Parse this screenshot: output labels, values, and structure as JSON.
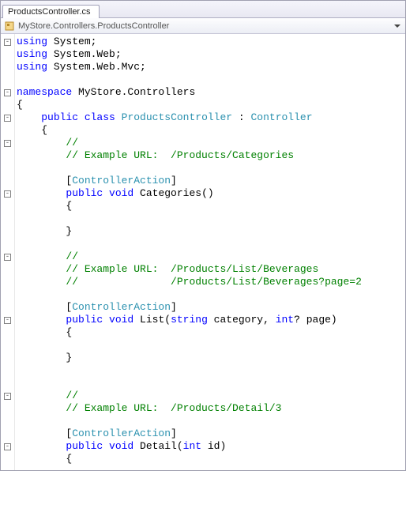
{
  "tab": {
    "title": "ProductsController.cs"
  },
  "nav": {
    "path": "MyStore.Controllers.ProductsController"
  },
  "code": {
    "lines": [
      {
        "fold": "-",
        "seg": [
          [
            "kw",
            "using"
          ],
          [
            "pl",
            " System;"
          ]
        ]
      },
      {
        "fold": "",
        "seg": [
          [
            "kw",
            "using"
          ],
          [
            "pl",
            " System.Web;"
          ]
        ]
      },
      {
        "fold": "",
        "seg": [
          [
            "kw",
            "using"
          ],
          [
            "pl",
            " System.Web.Mvc;"
          ]
        ]
      },
      {
        "fold": "",
        "seg": []
      },
      {
        "fold": "-",
        "seg": [
          [
            "kw",
            "namespace"
          ],
          [
            "pl",
            " MyStore.Controllers"
          ]
        ]
      },
      {
        "fold": "",
        "seg": [
          [
            "pl",
            "{"
          ]
        ]
      },
      {
        "fold": "-",
        "seg": [
          [
            "pl",
            "    "
          ],
          [
            "kw",
            "public class"
          ],
          [
            "pl",
            " "
          ],
          [
            "type",
            "ProductsController"
          ],
          [
            "pl",
            " : "
          ],
          [
            "type",
            "Controller"
          ]
        ]
      },
      {
        "fold": "",
        "seg": [
          [
            "pl",
            "    {"
          ]
        ]
      },
      {
        "fold": "-",
        "seg": [
          [
            "pl",
            "        "
          ],
          [
            "cm",
            "//"
          ]
        ]
      },
      {
        "fold": "",
        "seg": [
          [
            "pl",
            "        "
          ],
          [
            "cm",
            "// Example URL:  /Products/Categories"
          ]
        ]
      },
      {
        "fold": "",
        "seg": []
      },
      {
        "fold": "",
        "seg": [
          [
            "pl",
            "        ["
          ],
          [
            "type",
            "ControllerAction"
          ],
          [
            "pl",
            "]"
          ]
        ]
      },
      {
        "fold": "-",
        "seg": [
          [
            "pl",
            "        "
          ],
          [
            "kw",
            "public void"
          ],
          [
            "pl",
            " Categories()"
          ]
        ]
      },
      {
        "fold": "",
        "seg": [
          [
            "pl",
            "        {"
          ]
        ]
      },
      {
        "fold": "",
        "seg": []
      },
      {
        "fold": "",
        "seg": [
          [
            "pl",
            "        }"
          ]
        ]
      },
      {
        "fold": "",
        "seg": []
      },
      {
        "fold": "-",
        "seg": [
          [
            "pl",
            "        "
          ],
          [
            "cm",
            "//"
          ]
        ]
      },
      {
        "fold": "",
        "seg": [
          [
            "pl",
            "        "
          ],
          [
            "cm",
            "// Example URL:  /Products/List/Beverages"
          ]
        ]
      },
      {
        "fold": "",
        "seg": [
          [
            "pl",
            "        "
          ],
          [
            "cm",
            "//               /Products/List/Beverages?page=2"
          ]
        ]
      },
      {
        "fold": "",
        "seg": []
      },
      {
        "fold": "",
        "seg": [
          [
            "pl",
            "        ["
          ],
          [
            "type",
            "ControllerAction"
          ],
          [
            "pl",
            "]"
          ]
        ]
      },
      {
        "fold": "-",
        "seg": [
          [
            "pl",
            "        "
          ],
          [
            "kw",
            "public void"
          ],
          [
            "pl",
            " List("
          ],
          [
            "kw",
            "string"
          ],
          [
            "pl",
            " category, "
          ],
          [
            "kw",
            "int"
          ],
          [
            "pl",
            "? page)"
          ]
        ]
      },
      {
        "fold": "",
        "seg": [
          [
            "pl",
            "        {"
          ]
        ]
      },
      {
        "fold": "",
        "seg": []
      },
      {
        "fold": "",
        "seg": [
          [
            "pl",
            "        }"
          ]
        ]
      },
      {
        "fold": "",
        "seg": []
      },
      {
        "fold": "",
        "seg": []
      },
      {
        "fold": "-",
        "seg": [
          [
            "pl",
            "        "
          ],
          [
            "cm",
            "//"
          ]
        ]
      },
      {
        "fold": "",
        "seg": [
          [
            "pl",
            "        "
          ],
          [
            "cm",
            "// Example URL:  /Products/Detail/3"
          ]
        ]
      },
      {
        "fold": "",
        "seg": []
      },
      {
        "fold": "",
        "seg": [
          [
            "pl",
            "        ["
          ],
          [
            "type",
            "ControllerAction"
          ],
          [
            "pl",
            "]"
          ]
        ]
      },
      {
        "fold": "-",
        "seg": [
          [
            "pl",
            "        "
          ],
          [
            "kw",
            "public void"
          ],
          [
            "pl",
            " Detail("
          ],
          [
            "kw",
            "int"
          ],
          [
            "pl",
            " id)"
          ]
        ]
      },
      {
        "fold": "",
        "seg": [
          [
            "pl",
            "        {"
          ]
        ]
      },
      {
        "fold": "",
        "seg": []
      },
      {
        "fold": "",
        "seg": [
          [
            "pl",
            "        }"
          ]
        ]
      },
      {
        "fold": "",
        "seg": [
          [
            "pl",
            "    }"
          ]
        ]
      },
      {
        "fold": "",
        "seg": [
          [
            "pl",
            "}"
          ]
        ]
      }
    ]
  }
}
